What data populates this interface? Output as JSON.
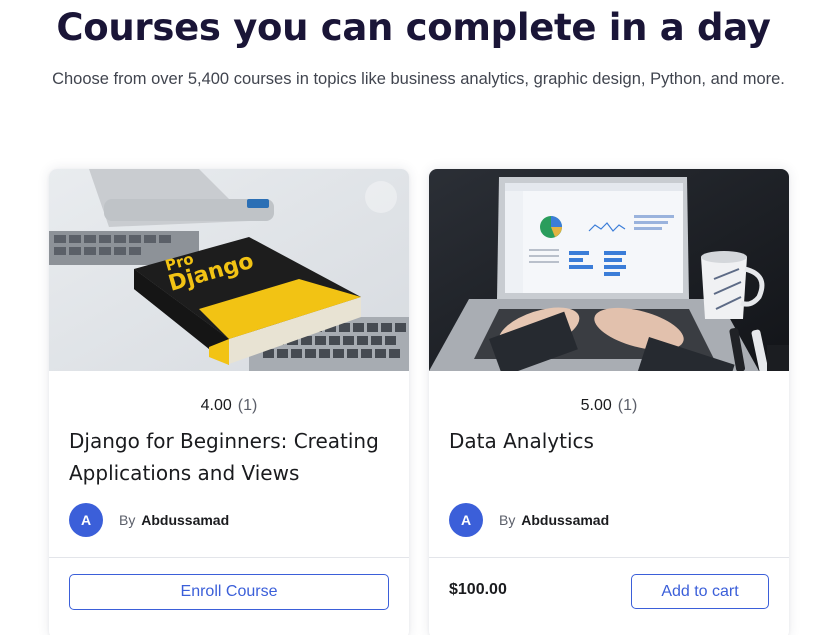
{
  "header": {
    "title": "Courses you can complete in a day",
    "subtitle": "Choose from over 5,400 courses in topics like business analytics, graphic design, Python, and more."
  },
  "courses": [
    {
      "rating": "4.00",
      "rating_count": "(1)",
      "title": "Django for Beginners: Creating Applications and Views",
      "avatar_initial": "A",
      "by_label": "By",
      "author": "Abdussamad",
      "action_label": "Enroll Course",
      "book_title_line1": "Pro",
      "book_title_line2": "Django"
    },
    {
      "rating": "5.00",
      "rating_count": "(1)",
      "title": "Data Analytics",
      "avatar_initial": "A",
      "by_label": "By",
      "author": "Abdussamad",
      "price": "$100.00",
      "action_label": "Add to cart"
    }
  ],
  "colors": {
    "accent": "#3b5fd9",
    "title_text": "#1a1537",
    "book_yellow": "#f2c314"
  }
}
